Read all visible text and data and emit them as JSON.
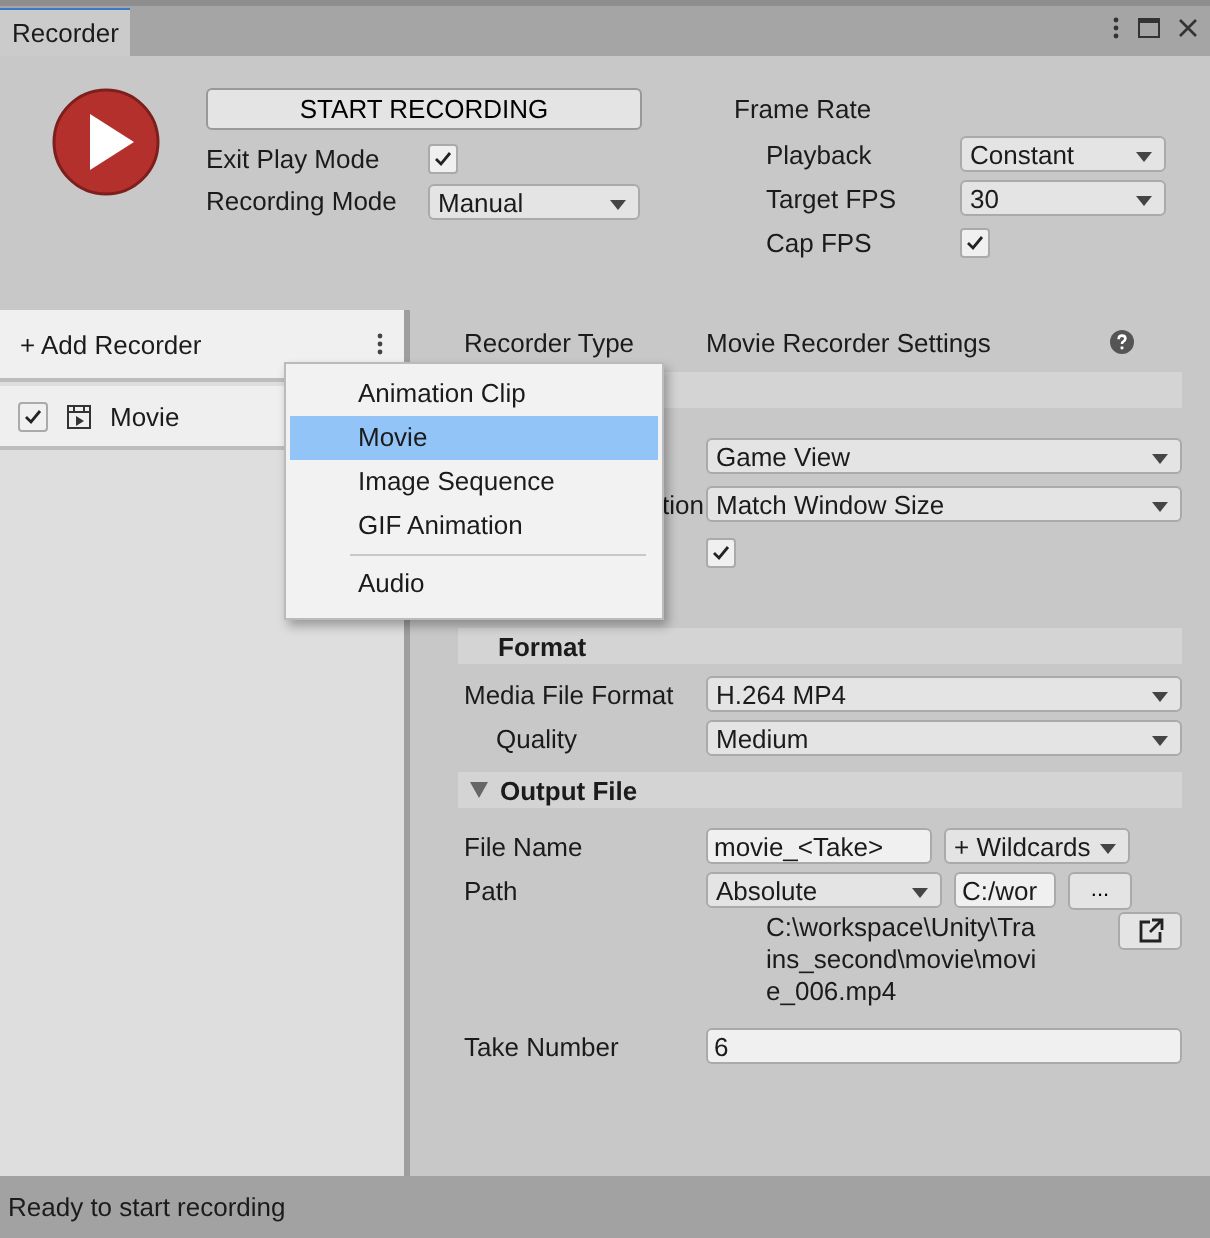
{
  "window": {
    "title": "Recorder"
  },
  "start_button": "START RECORDING",
  "exit_play_mode": {
    "label": "Exit Play Mode",
    "checked": true
  },
  "recording_mode": {
    "label": "Recording Mode",
    "value": "Manual"
  },
  "frame_rate": {
    "title": "Frame Rate",
    "playback": {
      "label": "Playback",
      "value": "Constant"
    },
    "target_fps": {
      "label": "Target FPS",
      "value": "30"
    },
    "cap_fps": {
      "label": "Cap FPS",
      "checked": true
    }
  },
  "recorder_list": {
    "add_label": "+ Add Recorder",
    "items": [
      {
        "name": "Movie",
        "enabled": true
      }
    ]
  },
  "add_menu": {
    "items": [
      {
        "label": "Animation Clip",
        "selected": false
      },
      {
        "label": "Movie",
        "selected": true
      },
      {
        "label": "Image Sequence",
        "selected": false
      },
      {
        "label": "GIF Animation",
        "selected": false
      }
    ],
    "extra_items": [
      {
        "label": "Audio",
        "selected": false
      }
    ]
  },
  "settings": {
    "recorder_type": {
      "label": "Recorder Type",
      "value": "Movie Recorder Settings"
    },
    "capture": {
      "rows": [
        {
          "kind": "dropdown",
          "value": "Game View"
        },
        {
          "kind": "dropdown",
          "label": "tion",
          "value": "Match Window Size"
        },
        {
          "kind": "checkbox",
          "checked": true
        }
      ]
    },
    "format": {
      "title": "Format",
      "rows": [
        {
          "kind": "dropdown",
          "label": "Media File Format",
          "value": "H.264 MP4",
          "children": [
            {
              "kind": "dropdown",
              "label": "Quality",
              "value": "Medium"
            }
          ]
        }
      ]
    },
    "output_file": {
      "title": "Output File",
      "expanded": true,
      "file_name": {
        "label": "File Name",
        "value": "movie_<Take>",
        "wildcards": "+ Wildcards"
      },
      "path": {
        "label": "Path",
        "mode": "Absolute",
        "folder": "C:/wor",
        "browse": "...",
        "resolved_lines": [
          "C:\\workspace\\Unity\\Tra",
          "ins_second\\movie\\movi",
          "e_006.mp4"
        ]
      },
      "take_number": {
        "label": "Take Number",
        "value": "6"
      }
    }
  },
  "status_bar": "Ready to start recording"
}
